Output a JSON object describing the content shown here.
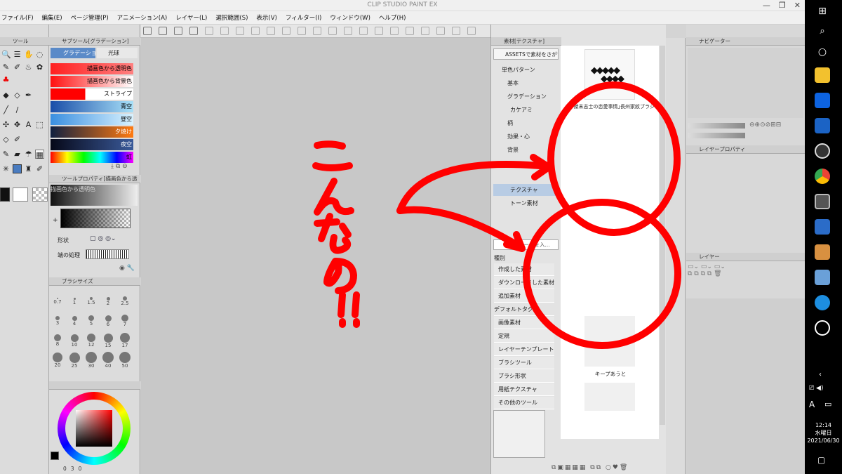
{
  "app": {
    "title": "CLIP STUDIO PAINT EX"
  },
  "menu": [
    "ファイル(F)",
    "編集(E)",
    "ページ管理(P)",
    "アニメーション(A)",
    "レイヤー(L)",
    "選択範囲(S)",
    "表示(V)",
    "フィルター(I)",
    "ウィンドウ(W)",
    "ヘルプ(H)"
  ],
  "tool_panel": {
    "title": "ツール"
  },
  "subtool_panel": {
    "title": "サブツール[グラデーション]",
    "tabs": [
      "グラデーショ",
      "光球"
    ],
    "gradients": [
      {
        "label": "描画色から透明色",
        "colors": [
          "#ff2020",
          "#ff8080"
        ]
      },
      {
        "label": "描画色から背景色",
        "colors": [
          "#ff1010",
          "#ffffff"
        ]
      },
      {
        "label": "ストライプ",
        "colors": [
          "#ff0000",
          "#ff0000"
        ]
      },
      {
        "label": "青空",
        "colors": [
          "#1a4ea8",
          "#a8e0f8"
        ]
      },
      {
        "label": "昼空",
        "colors": [
          "#3a8fe0",
          "#d8f2ff"
        ]
      },
      {
        "label": "夕焼け",
        "colors": [
          "#102040",
          "#ff7a10"
        ]
      },
      {
        "label": "夜空",
        "colors": [
          "#060818",
          "#3a5a9a"
        ]
      },
      {
        "label": "虹",
        "colors": [
          "#ff0000",
          "#8800ff"
        ]
      }
    ]
  },
  "tool_property": {
    "title": "ツールプロパティ[描画色から透明]",
    "preset_name": "描画色から透明色",
    "shape_label": "形状",
    "edge_label": "端の処理"
  },
  "brush_size": {
    "title": "ブラシサイズ",
    "sizes": [
      "0.7",
      "1",
      "1.5",
      "2",
      "2.5",
      "3",
      "4",
      "5",
      "6",
      "7",
      "8",
      "10",
      "12",
      "15",
      "17",
      "20",
      "25",
      "30",
      "40",
      "50"
    ]
  },
  "color_wheel": {
    "numbers": [
      "0",
      "3",
      "0"
    ]
  },
  "material_panel": {
    "title": "素材[テクスチャ]",
    "assets_button": "ASSETSで素材をさがす",
    "tree": [
      "単色パターン",
      "基本",
      "グラデーション",
      "カケアミ",
      "柄",
      "効果・心",
      "背景",
      "",
      "",
      "テクスチャ",
      "トーン素材"
    ],
    "search_placeholder": "キーワードを入...",
    "tags_header": "種別",
    "tags": [
      "作成した素材",
      "ダウンロードした素材",
      "追加素材",
      "デフォルトタグ",
      "画像素材",
      "定規",
      "レイヤーテンプレート",
      "ブラシツール",
      "ブラシ形状",
      "用紙テクスチャ",
      "その他のツール"
    ],
    "thumb_labels": [
      "桂ｰ傑末志士の恋愛事情｣長州家紋ブラシ",
      "キープあうと"
    ]
  },
  "right_panels": {
    "navigator": "ナビゲーター",
    "layer_property": "レイヤープロパティ",
    "layer": "レイヤー"
  },
  "taskbar": {
    "time": "12:14",
    "day": "水曜日",
    "date": "2021/06/30",
    "ime": "A"
  },
  "annotation": {
    "text_lines": [
      "こ",
      "ん",
      "な",
      "の",
      "!!"
    ],
    "color": "#ff0000"
  }
}
